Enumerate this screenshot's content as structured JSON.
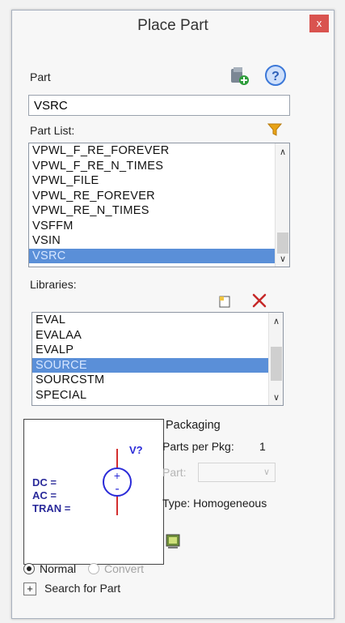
{
  "window": {
    "title": "Place Part",
    "close_glyph": "x"
  },
  "part": {
    "label": "Part",
    "value": "VSRC"
  },
  "part_list": {
    "label": "Part List:",
    "items": [
      "VPWL_F_RE_FOREVER",
      "VPWL_F_RE_N_TIMES",
      "VPWL_FILE",
      "VPWL_RE_FOREVER",
      "VPWL_RE_N_TIMES",
      "VSFFM",
      "VSIN",
      "VSRC"
    ],
    "selected": "VSRC"
  },
  "libraries": {
    "label": "Libraries:",
    "items": [
      "EVAL",
      "EVALAA",
      "EVALP",
      "SOURCE",
      "SOURCSTM",
      "SPECIAL"
    ],
    "selected": "SOURCE"
  },
  "preview": {
    "ref_label": "V?",
    "lines": [
      "DC =",
      "AC =",
      "TRAN ="
    ]
  },
  "packaging": {
    "title": "Packaging",
    "parts_per_pkg_label": "Parts per Pkg:",
    "parts_per_pkg_value": "1",
    "part_label": "Part:",
    "type_label": "Type: Homogeneous"
  },
  "view": {
    "normal_label": "Normal",
    "convert_label": "Convert"
  },
  "search": {
    "button_glyph": "+",
    "label": "Search for Part"
  },
  "colors": {
    "selection": "#5a8fd8",
    "close": "#d9534f",
    "filter": "#e8a317",
    "delete": "#c62828",
    "help": "#3c78d8"
  },
  "icons": [
    "add-library-icon",
    "help-icon",
    "filter-icon",
    "new-library-icon",
    "delete-icon",
    "scroll-up-arrow-icon",
    "scroll-down-arrow-icon",
    "voltage-source-symbol-icon",
    "pcb-footprint-icon"
  ]
}
